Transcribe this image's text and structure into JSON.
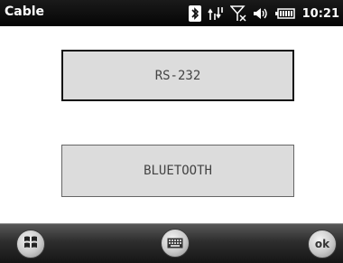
{
  "window": {
    "title": "Cable"
  },
  "status_bar": {
    "icons": [
      "bluetooth-icon",
      "data-connection-icon",
      "no-signal-icon",
      "volume-icon",
      "battery-icon"
    ],
    "time": "10:21"
  },
  "content": {
    "rs232_label": "RS-232",
    "bluetooth_label": "BLUETOOTH"
  },
  "softkeys": {
    "start_icon": "windows-logo-icon",
    "keyboard_icon": "keyboard-icon",
    "ok_label": "ok"
  },
  "colors": {
    "titlebar": "#0a0a0a",
    "button_fill": "#dcdcdc",
    "bottombar": "#2e2e2e"
  }
}
